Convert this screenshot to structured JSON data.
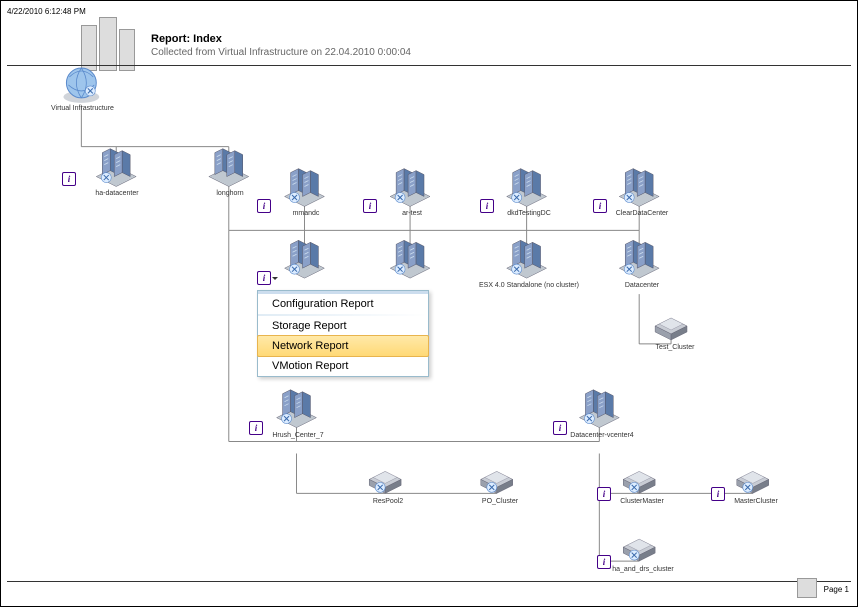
{
  "timestamp": "4/22/2010 6:12:48 PM",
  "report": {
    "title": "Report: Index",
    "subtitle": "Collected from Virtual Infrastructure on 22.04.2010 0:00:04"
  },
  "footer": {
    "page": "Page 1"
  },
  "labels": {
    "root": "Virtual Infrastructure",
    "ha": "ha-datacenter",
    "longhorn": "longhorn",
    "mmandc": "mmandc",
    "artest": "ar-test",
    "dkd": "dkdTestingDC",
    "clear": "ClearDataCenter",
    "esx": "ESX 4.0 Standalone (no cluster)",
    "dc": "Datacenter",
    "testcluster": "Test_Cluster",
    "hrush": "Hrush_Center_7",
    "dcv4": "Datacenter-vcenter4",
    "respool": "ResPool2",
    "pocluster": "PO_Cluster",
    "clustermaster": "ClusterMaster",
    "mastercluster": "MasterCluster",
    "hadrs": "ha_and_drs_cluster"
  },
  "menu": {
    "items": [
      "Configuration Report",
      "Storage Report",
      "Network Report",
      "VMotion Report"
    ],
    "selected": 2
  }
}
